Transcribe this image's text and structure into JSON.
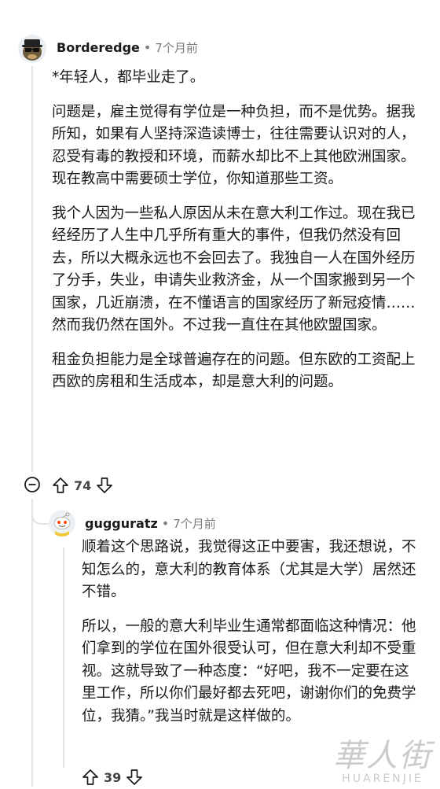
{
  "comment1": {
    "author": "Borderedge",
    "separator": "•",
    "time": "7个月前",
    "paragraphs": [
      "*年轻人，都毕业走了。",
      "问题是，雇主觉得有学位是一种负担，而不是优势。据我所知，如果有人坚持深造读博士，往往需要认识对的人，忍受有毒的教授和环境，而薪水却比不上其他欧洲国家。现在教高中需要硕士学位，你知道那些工资。",
      "我个人因为一些私人原因从未在意大利工作过。现在我已经经历了人生中几乎所有重大的事件，但我仍然没有回去，所以大概永远也不会回去了。我独自一人在国外经历了分手，失业，申请失业救济金，从一个国家搬到另一个国家，几近崩溃，在不懂语言的国家经历了新冠疫情……然而我仍然在国外。不过我一直住在其他欧盟国家。",
      "租金负担能力是全球普遍存在的问题。但东欧的工资配上西欧的房租和生活成本，却是意大利的问题。"
    ],
    "score": "74",
    "collapse_icon": "collapse-minus-icon",
    "upvote_icon": "upvote-arrow-icon",
    "downvote_icon": "downvote-arrow-icon"
  },
  "comment2": {
    "author": "gugguratz",
    "separator": "•",
    "time": "7个月前",
    "paragraphs": [
      "顺着这个思路说，我觉得这正中要害，我还想说，不知怎么的，意大利的教育体系（尤其是大学）居然还不错。",
      "所以，一般的意大利毕业生通常都面临这种情况：他们拿到的学位在国外很受认可，但在意大利却不受重视。这就导致了一种态度：“好吧，我不一定要在这里工作，所以你们最好都去死吧，谢谢你们的免费学位，我猜。”我当时就是这样做的。"
    ],
    "score": "39"
  },
  "watermark": {
    "main": "華人街",
    "sub": "HUARENJIE"
  },
  "colors": {
    "text": "#1a1a1b",
    "meta": "#7c7c7c",
    "thread": "#e3e3e3"
  }
}
